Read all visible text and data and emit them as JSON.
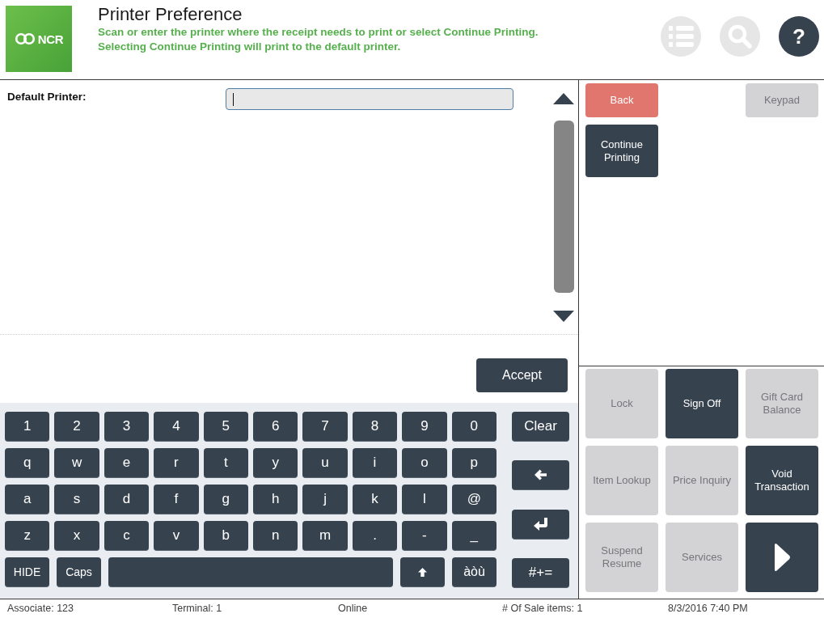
{
  "header": {
    "logo_text": "NCR",
    "title": "Printer Preference",
    "instructions": [
      "Scan or enter the printer where the receipt needs to print or select Continue Printing.",
      "Selecting Continue Printing will print to the default printer."
    ],
    "tool_buttons": [
      {
        "kind": "list",
        "disabled": true
      },
      {
        "kind": "search",
        "disabled": true
      },
      {
        "kind": "help",
        "label": "?",
        "disabled": false
      }
    ]
  },
  "form": {
    "field_label": "Default Printer:",
    "printer_field": {
      "focused": true
    }
  },
  "accept_button": {
    "label": "Accept"
  },
  "keyboard": {
    "rows": [
      [
        "1",
        "2",
        "3",
        "4",
        "5",
        "6",
        "7",
        "8",
        "9",
        "0"
      ],
      [
        "q",
        "w",
        "e",
        "r",
        "t",
        "y",
        "u",
        "i",
        "o",
        "p"
      ],
      [
        "a",
        "s",
        "d",
        "f",
        "g",
        "h",
        "j",
        "k",
        "l",
        "@"
      ],
      [
        "z",
        "x",
        "c",
        "v",
        "b",
        "n",
        "m",
        ".",
        "-",
        "_"
      ]
    ],
    "bottom_row": [
      {
        "kind": "text",
        "label": "HIDE"
      },
      {
        "kind": "text",
        "label": "Caps"
      },
      {
        "kind": "space"
      },
      {
        "kind": "shift"
      },
      {
        "kind": "text",
        "label": "àòù"
      }
    ],
    "side_keys": [
      {
        "kind": "text",
        "label": "Clear"
      },
      {
        "kind": "backspace"
      },
      {
        "kind": "enter"
      },
      {
        "kind": "text",
        "label": "#+="
      }
    ]
  },
  "actions": {
    "top_rows": [
      [
        {
          "kind": "alert",
          "label": "Back",
          "disabled": false
        },
        {
          "kind": "normal",
          "label": "Keypad",
          "disabled": true
        }
      ],
      [
        {
          "kind": "normal",
          "label": "Continue Printing",
          "disabled": false
        }
      ]
    ],
    "function_buttons": [
      {
        "kind": "text",
        "label": "Lock",
        "disabled": true
      },
      {
        "kind": "text",
        "label": "Sign Off",
        "disabled": false
      },
      {
        "kind": "text",
        "label": "Gift Card Balance",
        "disabled": true
      },
      {
        "kind": "text",
        "label": "Item Lookup",
        "disabled": true
      },
      {
        "kind": "text",
        "label": "Price Inquiry",
        "disabled": true
      },
      {
        "kind": "text",
        "label": "Void Transaction",
        "disabled": false
      },
      {
        "kind": "text",
        "label": "Suspend Resume",
        "disabled": true
      },
      {
        "kind": "text",
        "label": "Services",
        "disabled": true
      },
      {
        "kind": "next",
        "disabled": false
      }
    ]
  },
  "status_bar": [
    "Associate: 123",
    "Terminal: 1",
    "Online",
    "# Of Sale items: 1",
    "8/3/2016 7:40 PM"
  ]
}
